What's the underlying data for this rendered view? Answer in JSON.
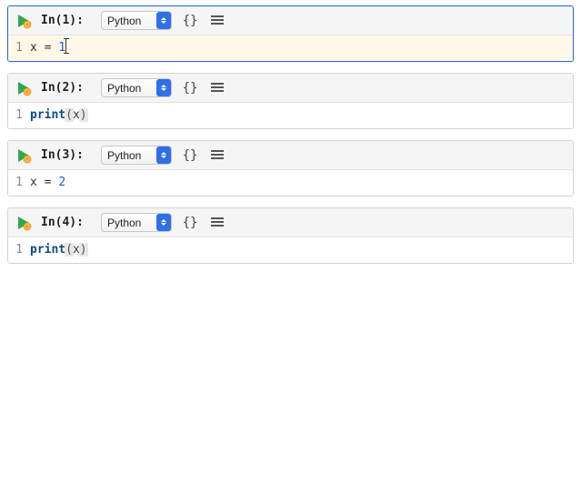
{
  "cells": [
    {
      "prompt": "In(1):",
      "language": "Python",
      "line_number": "1",
      "code_prefix": "x = ",
      "code_value": "1",
      "selected": true,
      "cursor_after_value": true,
      "highlight_parens": false,
      "is_print": false
    },
    {
      "prompt": "In(2):",
      "language": "Python",
      "line_number": "1",
      "code_prefix": "",
      "code_value": "",
      "print_keyword": "print",
      "print_arg": "x",
      "selected": false,
      "is_print": true,
      "highlight_parens": true
    },
    {
      "prompt": "In(3):",
      "language": "Python",
      "line_number": "1",
      "code_prefix": "x = ",
      "code_value": "2",
      "selected": false,
      "cursor_after_value": false,
      "highlight_parens": false,
      "is_print": false
    },
    {
      "prompt": "In(4):",
      "language": "Python",
      "line_number": "1",
      "code_prefix": "",
      "code_value": "",
      "print_keyword": "print",
      "print_arg": "x",
      "selected": false,
      "is_print": true,
      "highlight_parens": true
    }
  ],
  "toolbar": {
    "braces_label": "{}"
  }
}
